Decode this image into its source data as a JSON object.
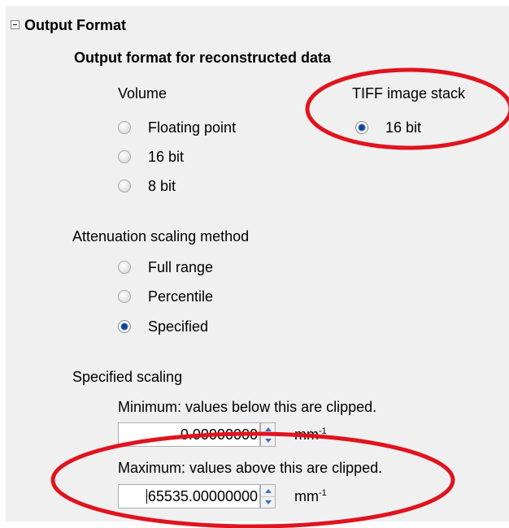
{
  "section": {
    "expander_symbol": "−",
    "title": "Output Format"
  },
  "output_format": {
    "heading": "Output format for reconstructed data",
    "volume": {
      "label": "Volume",
      "options": [
        "Floating point",
        "16 bit",
        "8 bit"
      ]
    },
    "tiff": {
      "label": "TIFF image stack",
      "options": [
        "16 bit"
      ],
      "selected": "16 bit"
    }
  },
  "attenuation": {
    "label": "Attenuation scaling method",
    "options": [
      "Full range",
      "Percentile",
      "Specified"
    ],
    "selected": "Specified"
  },
  "specified_scaling": {
    "label": "Specified scaling",
    "minimum": {
      "label": "Minimum: values below this are clipped.",
      "value": "0.00000000",
      "unit_base": "mm",
      "unit_exp": "-1"
    },
    "maximum": {
      "label": "Maximum: values above this are clipped.",
      "value": "65535.00000000",
      "unit_base": "mm",
      "unit_exp": "-1"
    }
  },
  "annotation_color": "#e0141e"
}
